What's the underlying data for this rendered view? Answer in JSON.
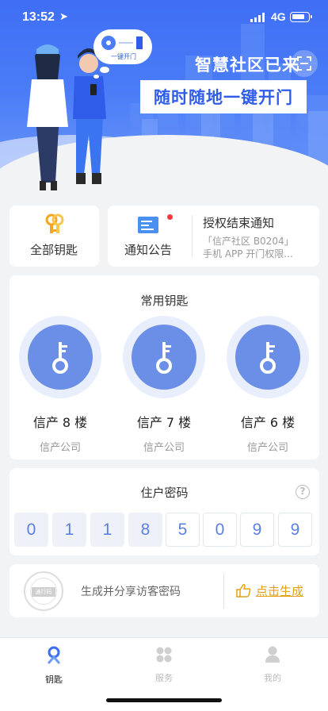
{
  "status_bar": {
    "time": "13:52",
    "network": "4G"
  },
  "hero": {
    "title": "智慧社区已来",
    "subtitle": "随时随地一键开门",
    "bubble_text": "一键开门"
  },
  "quick": {
    "all_keys_label": "全部钥匙",
    "notice_label": "通知公告",
    "notice_title": "授权结束通知",
    "notice_line1": "「信产社区 B0204」",
    "notice_line2": "手机 APP 开门权限..."
  },
  "common_keys": {
    "title": "常用钥匙",
    "items": [
      {
        "name": "信产 8 楼",
        "company": "信产公司"
      },
      {
        "name": "信产 7 楼",
        "company": "信产公司"
      },
      {
        "name": "信产 6 楼",
        "company": "信产公司"
      }
    ]
  },
  "password": {
    "title": "住户密码",
    "help": "?",
    "digits": [
      "0",
      "1",
      "1",
      "8",
      "5",
      "0",
      "9",
      "9"
    ]
  },
  "visitor": {
    "stamp_text": "通行码",
    "text": "生成并分享访客密码",
    "button": "点击生成"
  },
  "tabbar": {
    "tabs": [
      {
        "label": "钥匙",
        "active": true
      },
      {
        "label": "服务",
        "active": false
      },
      {
        "label": "我的",
        "active": false
      }
    ]
  },
  "colors": {
    "primary": "#4a7cf7",
    "key": "#6b8fe7",
    "accent": "#e3a019",
    "alert": "#f23c3c"
  }
}
